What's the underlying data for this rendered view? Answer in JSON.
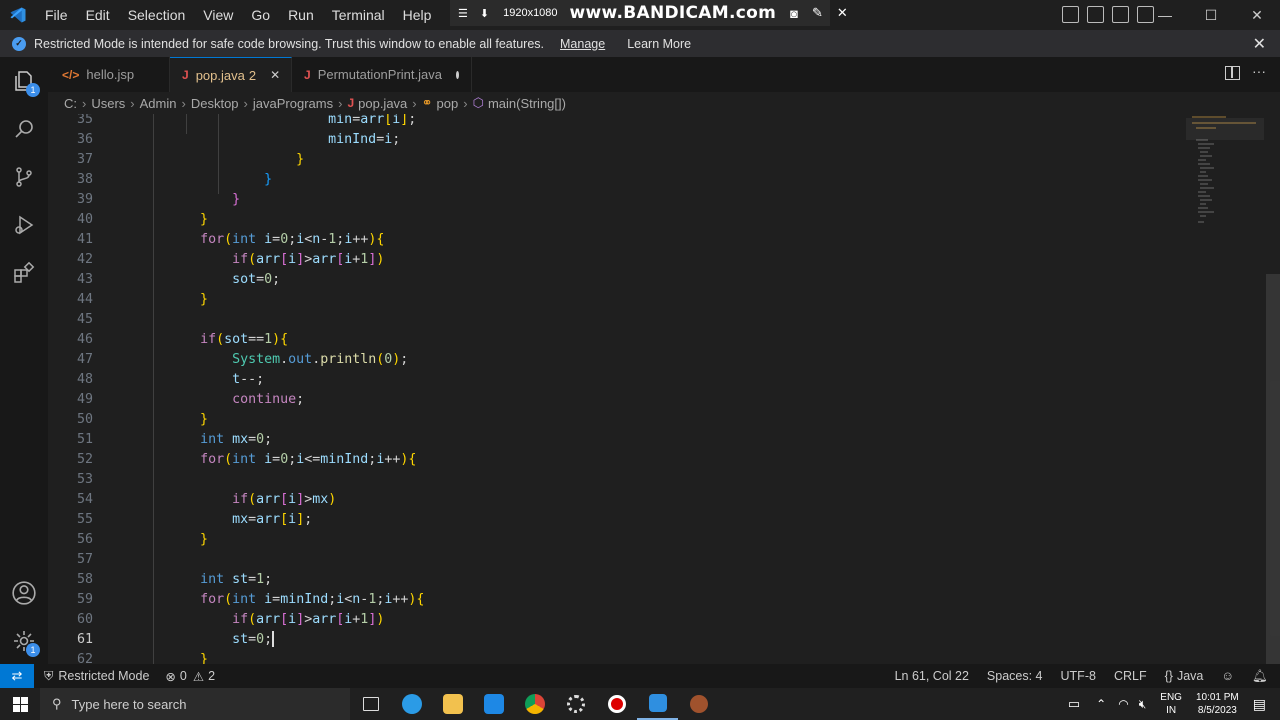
{
  "menu": [
    "File",
    "Edit",
    "Selection",
    "View",
    "Go",
    "Run",
    "Terminal",
    "Help"
  ],
  "overlay": {
    "resolution": "1920x1080",
    "logo": "www.BANDICAM.com"
  },
  "banner": {
    "message": "Restricted Mode is intended for safe code browsing. Trust this window to enable all features.",
    "manage": "Manage",
    "learn_more": "Learn More"
  },
  "tabs": [
    {
      "label": "hello.jsp",
      "icon": "jsp-file-icon"
    },
    {
      "label": "pop.java",
      "badge": "2",
      "icon": "java-file-icon"
    },
    {
      "label": "PermutationPrint.java",
      "icon": "java-file-icon"
    }
  ],
  "breadcrumb": [
    "C:",
    "Users",
    "Admin",
    "Desktop",
    "javaPrograms",
    "pop.java",
    "pop",
    "main(String[])"
  ],
  "code": [
    {
      "n": "35",
      "text": "                  min=arr[i];"
    },
    {
      "n": "36",
      "text": "                  minInd=i;"
    },
    {
      "n": "37",
      "text": "              }"
    },
    {
      "n": "38",
      "text": "          }"
    },
    {
      "n": "39",
      "text": "      }"
    },
    {
      "n": "40",
      "text": "  }"
    },
    {
      "n": "41",
      "text": "  for(int i=0;i<n-1;i++){"
    },
    {
      "n": "42",
      "text": "      if(arr[i]>arr[i+1])"
    },
    {
      "n": "43",
      "text": "      sot=0;"
    },
    {
      "n": "44",
      "text": "  }"
    },
    {
      "n": "45",
      "text": ""
    },
    {
      "n": "46",
      "text": "  if(sot==1){"
    },
    {
      "n": "47",
      "text": "      System.out.println(0);"
    },
    {
      "n": "48",
      "text": "      t--;"
    },
    {
      "n": "49",
      "text": "      continue;"
    },
    {
      "n": "50",
      "text": "  }"
    },
    {
      "n": "51",
      "text": "  int mx=0;"
    },
    {
      "n": "52",
      "text": "  for(int i=0;i<=minInd;i++){"
    },
    {
      "n": "53",
      "text": ""
    },
    {
      "n": "54",
      "text": "      if(arr[i]>mx)"
    },
    {
      "n": "55",
      "text": "      mx=arr[i];"
    },
    {
      "n": "56",
      "text": "  }"
    },
    {
      "n": "57",
      "text": ""
    },
    {
      "n": "58",
      "text": "  int st=1;"
    },
    {
      "n": "59",
      "text": "  for(int i=minInd;i<n-1;i++){"
    },
    {
      "n": "60",
      "text": "      if(arr[i]>arr[i+1])"
    },
    {
      "n": "61",
      "text": "      st=0;"
    },
    {
      "n": "62",
      "text": "  }"
    }
  ],
  "current_line": "61",
  "status": {
    "restricted": "Restricted Mode",
    "errors": "0",
    "warnings": "2",
    "position": "Ln 61, Col 22",
    "spaces": "Spaces: 4",
    "encoding": "UTF-8",
    "eol": "CRLF",
    "language": "Java"
  },
  "taskbar": {
    "search_placeholder": "Type here to search",
    "lang_top": "ENG",
    "lang_bottom": "IN",
    "time": "10:01 PM",
    "date": "8/5/2023"
  },
  "colors": {
    "accent": "#0078d4",
    "keyword": "#569cd6",
    "control": "#c586c0",
    "variable": "#9cdcfe",
    "number": "#b5cea8",
    "function": "#dcdcaa",
    "type": "#4ec9b0",
    "bracket1": "#ffd700",
    "bracket2": "#da70d6",
    "bracket3": "#179fff"
  }
}
